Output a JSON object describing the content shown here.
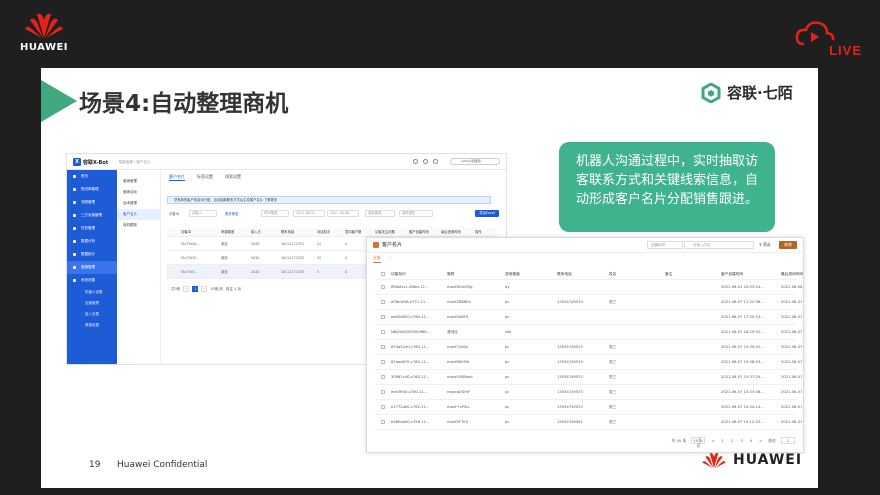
{
  "brand": {
    "huawei": "HUAWEI",
    "live": "LIVE"
  },
  "slide": {
    "title": "场景4:自动整理商机",
    "partner_logo": "容联·七陌",
    "callout": "机器人沟通过程中，实时抽取访客联系方式和关键线索信息，自动形成客户名片分配销售跟进。",
    "page_number": "19",
    "confidential": "Huawei Confidential",
    "accent_color": "#41a77f"
  },
  "left_app": {
    "app_name": "容联X-Bot",
    "breadcrumb": "智能客服 / 客户名片",
    "user": "active(管理员)",
    "sidebar": [
      {
        "label": "首页"
      },
      {
        "label": "知识库管理"
      },
      {
        "label": "流程管理"
      },
      {
        "label": "三方对接管理"
      },
      {
        "label": "任务管理"
      },
      {
        "label": "数据分析"
      },
      {
        "label": "数据统计"
      },
      {
        "label": "营销管理"
      },
      {
        "label": "系统设置"
      }
    ],
    "sidebar_sub": [
      "机器人设置",
      "坐席管理",
      "接入设置",
      "渠道设置"
    ],
    "submenu": [
      "营销管理",
      "营销活动",
      "话术管理",
      "客户名片",
      "商机跟踪"
    ],
    "tabs": [
      "客户名片",
      "标签设置",
      "线索设置"
    ],
    "notice": "您有新的客户信息待分配，自动抽取联系方式后生成客户名片  了解更多",
    "filters": {
      "label": "访客ID",
      "ph1": "请输入",
      "link": "更多筛选",
      "date_label": "时间筛选",
      "date1": "2021-06-01",
      "date2": "2021-06-08",
      "ph2": "选择渠道",
      "ph3": "选择销售",
      "button": "导出Excel"
    },
    "columns": [
      "",
      "访客ID",
      "来源渠道",
      "接入方",
      "联系电话",
      "对话轮次",
      "意向客户数",
      "访客关注问题",
      "客户创建时间",
      "最后咨询时间",
      "操作"
    ],
    "rows": [
      [
        "",
        "f3c27e5b...",
        "渠道",
        "2020",
        "18111172331",
        "22",
        "0",
        "-",
        "-",
        "-",
        "-"
      ],
      [
        "",
        "f3c27d3f...",
        "渠道",
        "2020",
        "18111172332",
        "22",
        "0",
        "-",
        "-",
        "-",
        "-"
      ],
      [
        "",
        "f3c27d5...",
        "渠道",
        "2020",
        "18111172335",
        "5",
        "0",
        "-",
        "-",
        "-",
        "-"
      ]
    ],
    "pager": {
      "total": "共3条",
      "page": "1",
      "size": "10条/页",
      "goto": "前往 1 页"
    }
  },
  "right_app": {
    "title": "客户名片",
    "select": "访客标识",
    "search_placeholder": "请输入内容",
    "filter": "筛选",
    "add": "新增",
    "tab_active": "全部",
    "tab_other": "✓",
    "columns": [
      "访客标识",
      "昵称",
      "咨询渠道",
      "联系电话",
      "姓名",
      "备注",
      "客户创建时间",
      "最后咨询时间"
    ],
    "rows": [
      [
        "f89a8cc1-83bb-12...",
        "monf8Gm9Zg",
        "dy",
        "",
        "",
        "",
        "2021-06-01 20:53:24...",
        "2021-06-08 18:32:23..."
      ],
      [
        "ef5b0e58-e771-11...",
        "monfZ8BBEx",
        "pc",
        "13534749533",
        "张三",
        "",
        "2021-06-07 17:22:36...",
        "2021-06-07 17:22:39..."
      ],
      [
        "eeb56620-c760-11...",
        "monfSA6Y9",
        "pc",
        "",
        "",
        "",
        "2021-06-07 17:20:23...",
        "2021-06-07 17:20:23..."
      ],
      [
        "N60000000000966...",
        "清河区",
        "sdk",
        "",
        "",
        "",
        "2021-06-07 16:29:52...",
        "2021-06-07 16:29:52..."
      ],
      [
        "853a42e0-c760-11...",
        "monf72d0y",
        "pc",
        "13534749533",
        "张三",
        "",
        "2021-06-07 15:39:42...",
        "2021-06-07 15:39:42..."
      ],
      [
        "87aee870-c760-11...",
        "monf6K0F6r",
        "pc",
        "13534749533",
        "张三",
        "",
        "2021-06-07 15:38:53...",
        "2021-06-07 15:38:53..."
      ],
      [
        "30987c40-c760-11...",
        "monfr2NRbxb",
        "pc",
        "13534749533",
        "张三",
        "",
        "2021-06-07 15:37:29...",
        "2021-06-07 15:37:29..."
      ],
      [
        "eee3ff40-c760-11...",
        "monrgDSHlF",
        "pc",
        "13534749533",
        "张三",
        "",
        "2021-06-07 15:33:48...",
        "2021-06-07 15:33:48..."
      ],
      [
        "e1772ae0-c762-11...",
        "monf+vPSLr",
        "pc",
        "13534749533",
        "张三",
        "",
        "2021-06-07 15:34:14...",
        "2021-06-07 15:34:14..."
      ],
      [
        "b580ea00-c758-11...",
        "monf0F7K0",
        "pc",
        "15942346561",
        "张三",
        "",
        "2021-06-07 15:12:25...",
        "2021-06-07 15:12:25..."
      ]
    ],
    "pager": {
      "total": "共 40 条",
      "pages": [
        "<",
        "1",
        "2",
        "3",
        "4",
        ">"
      ],
      "size": "10条/页",
      "goto": "前往",
      "page": "1"
    }
  }
}
